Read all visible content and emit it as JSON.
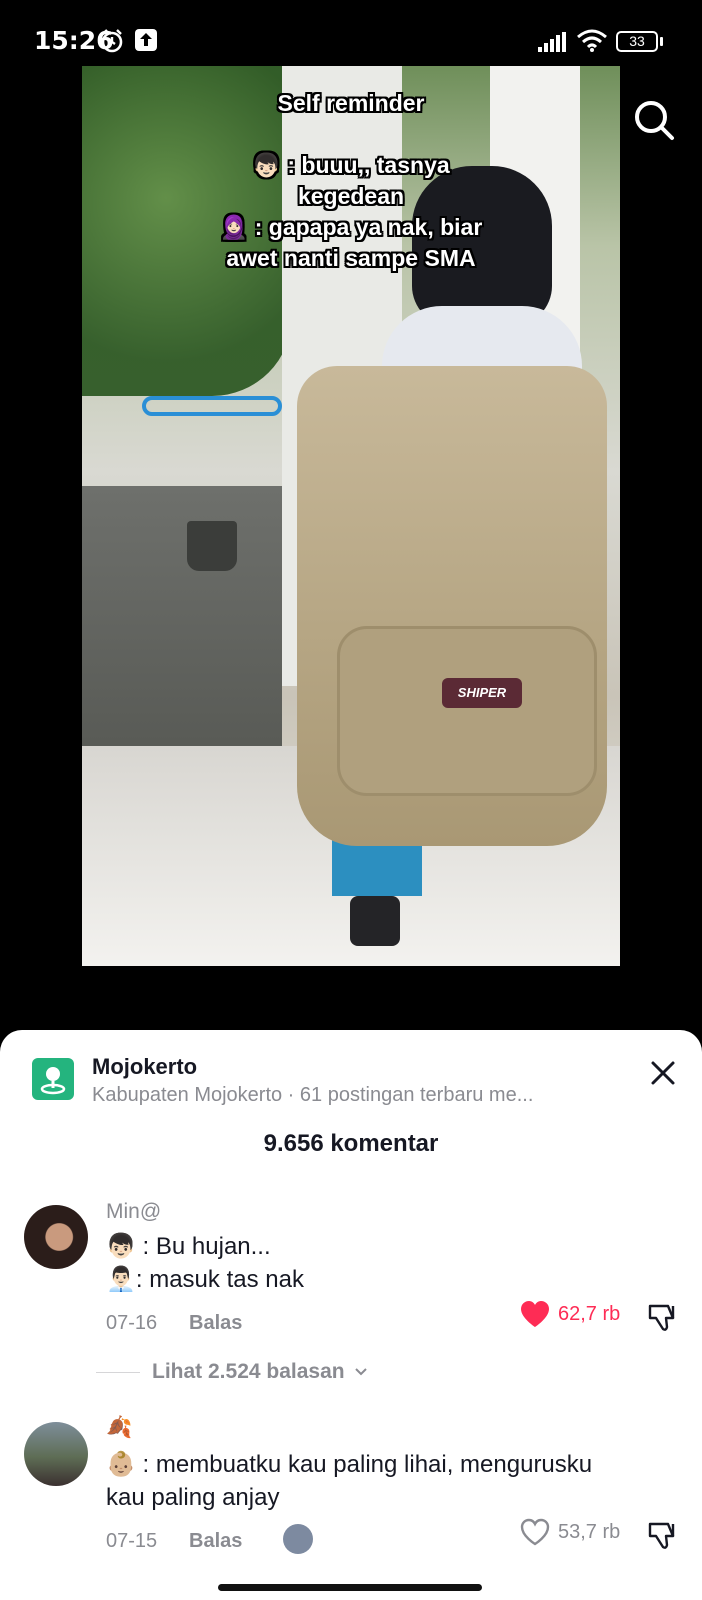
{
  "status_bar": {
    "time": "15:26",
    "battery": "33",
    "icons": [
      "alarm-icon",
      "upload-icon",
      "signal-icon",
      "wifi-icon",
      "battery-icon"
    ]
  },
  "video": {
    "overlay_lines": [
      "Self reminder",
      "",
      "👦🏻 : buuu,, tasnya",
      "kegedean",
      "🧕🏻 : gapapa ya nak, biar",
      "awet nanti sampe SMA"
    ],
    "bag_brand": "SHIPER"
  },
  "location": {
    "title": "Mojokerto",
    "subtitle": "Kabupaten Mojokerto · 61 postingan terbaru me..."
  },
  "comments_header": "9.656 komentar",
  "comments": [
    {
      "username": "Min@",
      "lines": [
        "👦🏻 : Bu hujan...",
        "👨🏻‍💼: masuk tas nak"
      ],
      "date": "07-16",
      "reply_label": "Balas",
      "likes": "62,7 rb",
      "liked": true,
      "view_replies": "Lihat 2.524 balasan"
    },
    {
      "username": "🍂",
      "lines": [
        "👶🏼 : membuatku kau paling lihai, mengurusku",
        "kau paling anjay"
      ],
      "date": "07-15",
      "reply_label": "Balas",
      "likes": "53,7 rb",
      "liked": false
    }
  ],
  "colors": {
    "like_red": "#fe2c55",
    "location_green": "#24b47e",
    "text_primary": "#161823",
    "text_secondary": "#8a8b91"
  }
}
